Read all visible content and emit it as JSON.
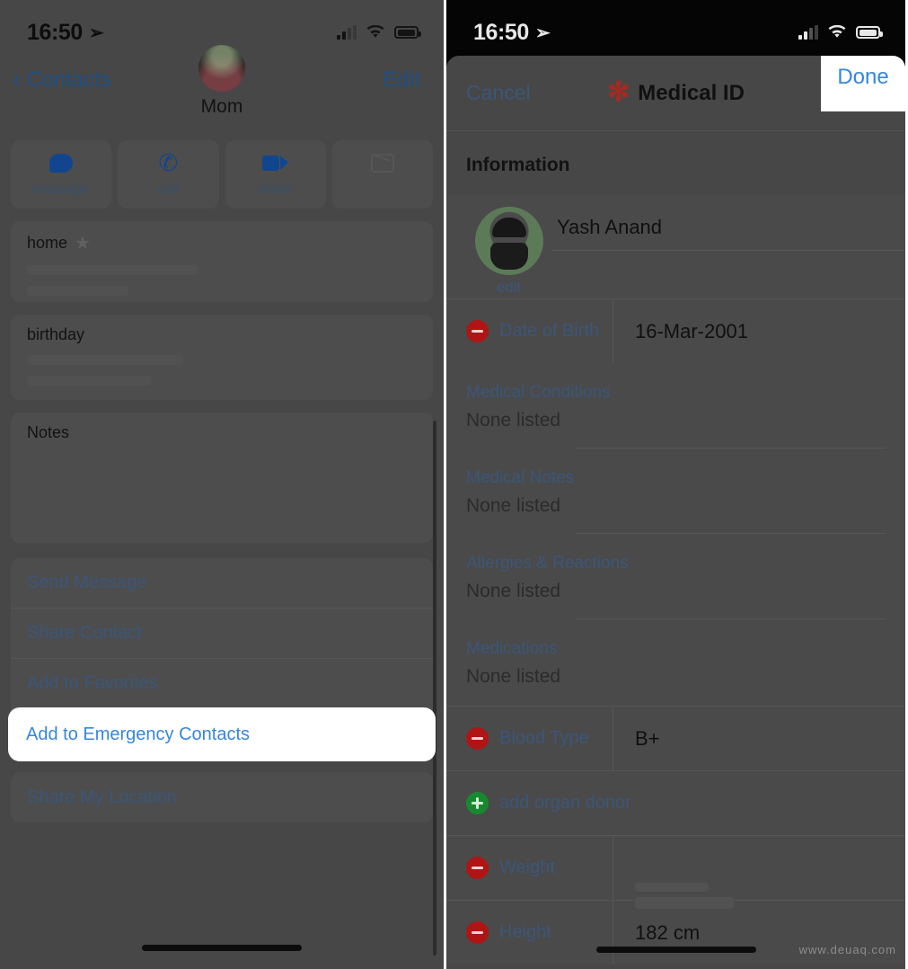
{
  "left": {
    "status": {
      "time": "16:50",
      "location_icon": "location-arrow-icon",
      "signal_icon": "signal-bars-icon",
      "wifi_icon": "wifi-icon",
      "battery_icon": "battery-icon"
    },
    "nav": {
      "back_label": "Contacts",
      "back_icon": "chevron-left-icon",
      "edit_label": "Edit"
    },
    "contact": {
      "name": "Mom",
      "avatar_icon": "contact-avatar"
    },
    "quick_actions": [
      {
        "label": "message",
        "icon": "message-bubble-icon",
        "enabled": true
      },
      {
        "label": "call",
        "icon": "phone-icon",
        "enabled": true
      },
      {
        "label": "video",
        "icon": "video-camera-icon",
        "enabled": true
      },
      {
        "label": "mail",
        "icon": "mail-icon",
        "enabled": false
      }
    ],
    "fields": [
      {
        "label": "home",
        "badge_icon": "star-icon"
      },
      {
        "label": "birthday"
      },
      {
        "label": "Notes"
      }
    ],
    "actions": [
      {
        "label": "Send Message",
        "highlight": false
      },
      {
        "label": "Share Contact",
        "highlight": false
      },
      {
        "label": "Add to Favorites",
        "highlight": false
      },
      {
        "label": "Add to Emergency Contacts",
        "highlight": true
      },
      {
        "label": "Share My Location",
        "highlight": false
      }
    ]
  },
  "right": {
    "status": {
      "time": "16:50",
      "location_icon": "location-arrow-icon",
      "signal_icon": "signal-bars-icon",
      "wifi_icon": "wifi-icon",
      "battery_icon": "battery-icon"
    },
    "sheet_nav": {
      "cancel_label": "Cancel",
      "title": "Medical ID",
      "title_icon": "medical-asterisk-icon",
      "done_label": "Done"
    },
    "section_title": "Information",
    "profile": {
      "name": "Yash Anand",
      "edit_label": "edit",
      "avatar_icon": "user-photo-avatar"
    },
    "kv_rows_top": [
      {
        "icon": "minus-circle-icon",
        "key": "Date of Birth",
        "value": "16-Mar-2001",
        "blurred": false
      }
    ],
    "list_rows": [
      {
        "label": "Medical Conditions",
        "value": "None listed"
      },
      {
        "label": "Medical Notes",
        "value": "None listed"
      },
      {
        "label": "Allergies & Reactions",
        "value": "None listed"
      },
      {
        "label": "Medications",
        "value": "None listed"
      }
    ],
    "kv_rows_bottom": [
      {
        "icon": "minus-circle-icon",
        "key": "Blood Type",
        "value": "B+",
        "blurred": false
      },
      {
        "icon": "plus-circle-icon",
        "key": "add organ donor",
        "value": "",
        "blurred": false
      },
      {
        "icon": "minus-circle-icon",
        "key": "Weight",
        "value": "",
        "blurred": true
      },
      {
        "icon": "minus-circle-icon",
        "key": "Height",
        "value": "182 cm",
        "blurred": false
      }
    ],
    "watermark": "www.deuaq.com"
  },
  "colors": {
    "dim_background": "#474747",
    "card_background": "#4d4d4d",
    "link_blue": "#3b567a",
    "highlight_blue": "#3586e0",
    "medical_red": "#a32a20",
    "minus_red": "#b01414",
    "plus_green": "#16892f"
  }
}
